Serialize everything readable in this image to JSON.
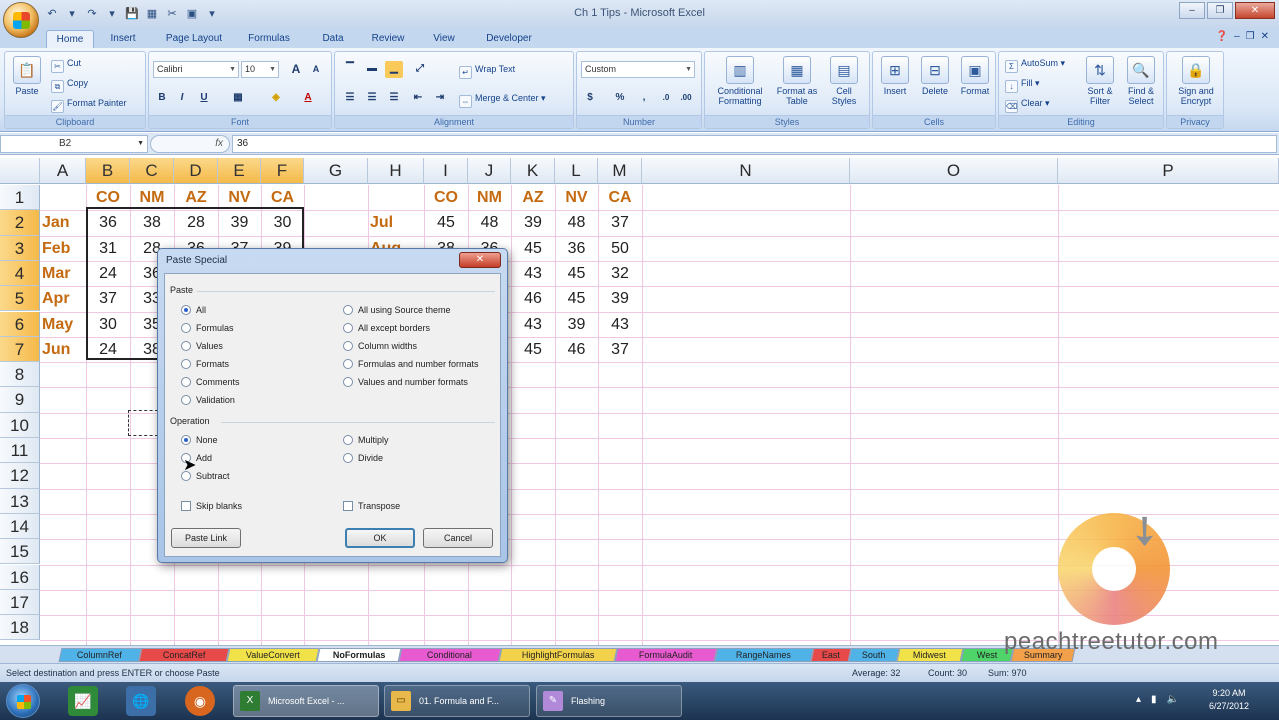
{
  "window": {
    "title": "Ch 1 Tips - Microsoft Excel",
    "controls": [
      "–",
      "❐",
      "✕"
    ]
  },
  "qat": [
    "↶",
    "▾",
    "↷",
    "▾",
    "💾",
    "▦",
    "✂",
    "▣",
    "▾"
  ],
  "ribbon": {
    "tabs": [
      "Home",
      "Insert",
      "Page Layout",
      "Formulas",
      "Data",
      "Review",
      "View",
      "Developer"
    ],
    "active_tab": "Home",
    "groups": {
      "clipboard": {
        "label": "Clipboard",
        "paste": "Paste",
        "cut": "Cut",
        "copy": "Copy",
        "format_painter": "Format Painter"
      },
      "font": {
        "label": "Font",
        "font_name": "Calibri",
        "font_size": "10",
        "bold": "B",
        "italic": "I",
        "underline": "U",
        "grow": "A",
        "shrink": "A"
      },
      "alignment": {
        "label": "Alignment",
        "wrap_text": "Wrap Text",
        "merge_center": "Merge & Center"
      },
      "number": {
        "label": "Number",
        "format": "Custom",
        "currency": "$",
        "percent": "%",
        "comma": ","
      },
      "styles": {
        "label": "Styles",
        "conditional": "Conditional Formatting",
        "format_table": "Format as Table",
        "cell_styles": "Cell Styles"
      },
      "cells": {
        "label": "Cells",
        "insert": "Insert",
        "delete": "Delete",
        "format": "Format"
      },
      "editing": {
        "label": "Editing",
        "autosum": "AutoSum",
        "fill": "Fill",
        "clear": "Clear",
        "sort_filter": "Sort & Filter",
        "find_select": "Find & Select"
      },
      "privacy": {
        "label": "Privacy",
        "sign_encrypt": "Sign and Encrypt"
      }
    }
  },
  "formula_bar": {
    "name_box": "B2",
    "fx": "fx",
    "value": "36"
  },
  "grid": {
    "columns": [
      "A",
      "B",
      "C",
      "D",
      "E",
      "F",
      "G",
      "H",
      "I",
      "J",
      "K",
      "L",
      "M",
      "N",
      "O",
      "P"
    ],
    "rows": [
      "1",
      "2",
      "3",
      "4",
      "5",
      "6",
      "7",
      "8",
      "9",
      "10",
      "11",
      "12",
      "13",
      "14",
      "15",
      "16",
      "17",
      "18"
    ],
    "left_headers": [
      "CO",
      "NM",
      "AZ",
      "NV",
      "CA"
    ],
    "right_headers": [
      "CO",
      "NM",
      "AZ",
      "NV",
      "CA"
    ],
    "left_months": [
      "Jan",
      "Feb",
      "Mar",
      "Apr",
      "May",
      "Jun"
    ],
    "right_months": [
      "Jul",
      "Aug"
    ],
    "left_values": [
      [
        "36",
        "38",
        "28",
        "39",
        "30"
      ],
      [
        "31",
        "28",
        "36",
        "37",
        "39"
      ],
      [
        "24",
        "36"
      ],
      [
        "37",
        "33"
      ],
      [
        "30",
        "35"
      ],
      [
        "24",
        "38"
      ]
    ],
    "right_values": [
      [
        "45",
        "48",
        "39",
        "48",
        "37"
      ],
      [
        "38",
        "36",
        "45",
        "36",
        "50"
      ],
      [
        "",
        "",
        "43",
        "45",
        "32"
      ],
      [
        "",
        "",
        "46",
        "45",
        "39"
      ],
      [
        "",
        "",
        "43",
        "39",
        "43"
      ],
      [
        "",
        "",
        "45",
        "46",
        "37"
      ]
    ]
  },
  "dialog": {
    "title": "Paste Special",
    "close": "✕",
    "paste_label": "Paste",
    "paste_options_left": [
      "All",
      "Formulas",
      "Values",
      "Formats",
      "Comments",
      "Validation"
    ],
    "paste_options_right": [
      "All using Source theme",
      "All except borders",
      "Column widths",
      "Formulas and number formats",
      "Values and number formats"
    ],
    "paste_selected": "All",
    "operation_label": "Operation",
    "operation_left": [
      "None",
      "Add",
      "Subtract"
    ],
    "operation_right": [
      "Multiply",
      "Divide"
    ],
    "operation_selected": "None",
    "skip_blanks": "Skip blanks",
    "transpose": "Transpose",
    "paste_link": "Paste Link",
    "ok": "OK",
    "cancel": "Cancel"
  },
  "sheet_tabs": [
    {
      "label": "ColumnRef",
      "color": "#4fb3e8"
    },
    {
      "label": "ConcatRef",
      "color": "#e84a4a"
    },
    {
      "label": "ValueConvert",
      "color": "#f2e24a"
    },
    {
      "label": "NoFormulas",
      "color": "#ffffff"
    },
    {
      "label": "Conditional",
      "color": "#e85ad0"
    },
    {
      "label": "HighlightFormulas",
      "color": "#f2d24a"
    },
    {
      "label": "FormulaAudit",
      "color": "#e85ad0"
    },
    {
      "label": "RangeNames",
      "color": "#4fb3e8"
    },
    {
      "label": "East",
      "color": "#e84a4a"
    },
    {
      "label": "South",
      "color": "#4fb3e8"
    },
    {
      "label": "Midwest",
      "color": "#f2e24a"
    },
    {
      "label": "West",
      "color": "#4fd46a"
    },
    {
      "label": "Summary",
      "color": "#f2a04a"
    }
  ],
  "active_sheet": "NoFormulas",
  "status": {
    "message": "Select destination and press ENTER or choose Paste",
    "average": "Average: 32",
    "count": "Count: 30",
    "sum": "Sum: 970"
  },
  "watermark": "peachtreetutor.com",
  "taskbar": {
    "tasks": [
      "Microsoft Excel - ...",
      "01. Formula and F...",
      "Flashing"
    ],
    "clock_time": "9:20 AM",
    "clock_date": "6/27/2012"
  },
  "colors": {
    "accent": "#f5b94a",
    "header_text": "#c46a10",
    "gridline": "#f0c8e4"
  }
}
